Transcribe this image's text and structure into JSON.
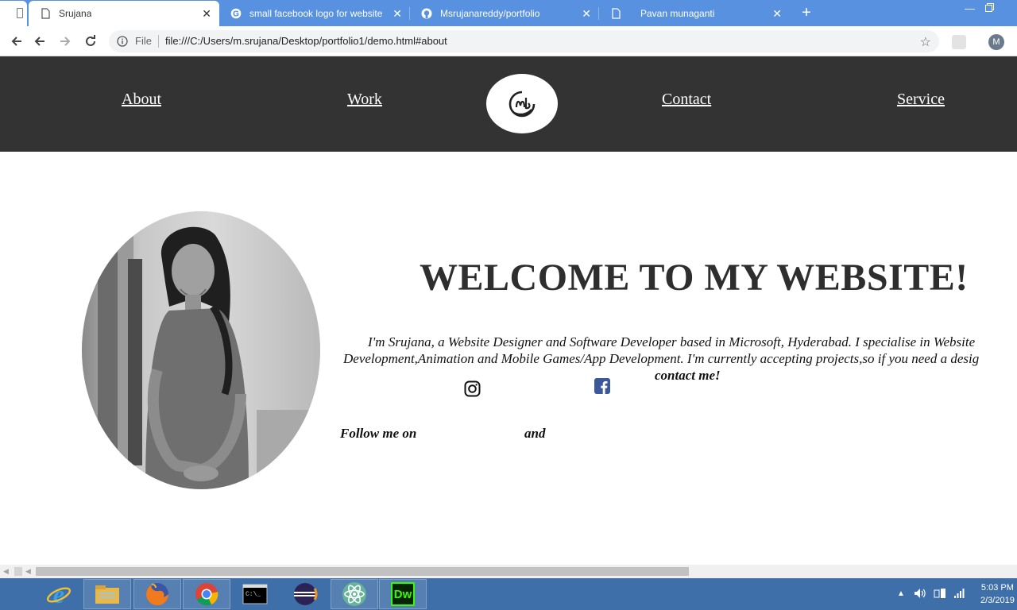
{
  "browser": {
    "tabs": [
      {
        "title": "Srujana",
        "active": true,
        "icon": "page-icon"
      },
      {
        "title": "small facebook logo for website",
        "active": false,
        "icon": "google-icon"
      },
      {
        "title": "Msrujanareddy/portfolio",
        "active": false,
        "icon": "github-icon"
      },
      {
        "title": "Pavan munaganti",
        "active": false,
        "icon": "page-icon"
      }
    ],
    "scheme_label": "File",
    "url": "file:///C:/Users/m.srujana/Desktop/portfolio1/demo.html#about",
    "profile_initial": "M"
  },
  "site": {
    "nav": {
      "about": "About",
      "work": "Work",
      "contact": "Contact",
      "service": "Service"
    },
    "headline": "WELCOME TO MY WEBSITE!",
    "bio_line1": "I'm Srujana, a Website Designer and Software Developer based in Microsoft, Hyderabad. I specialise in Website",
    "bio_line2": "Development,Animation and Mobile Games/App Development. I'm currently accepting projects,so if you need a desig",
    "bio_cta": "contact me!",
    "follow_text": "Follow me on",
    "follow_and": "and",
    "social": [
      "instagram-icon",
      "facebook-icon"
    ]
  },
  "taskbar": {
    "apps": [
      "internet-explorer-icon",
      "file-explorer-icon",
      "firefox-icon",
      "chrome-icon",
      "command-prompt-icon",
      "eclipse-icon",
      "atom-icon",
      "dreamweaver-icon"
    ],
    "dw_label": "Dw",
    "time": "5:03 PM",
    "date": "2/3/2019"
  },
  "colors": {
    "tabstrip": "#5891e0",
    "site_nav": "#333333",
    "headline": "#2e2e2e",
    "taskbar": "#3f6fa8"
  }
}
